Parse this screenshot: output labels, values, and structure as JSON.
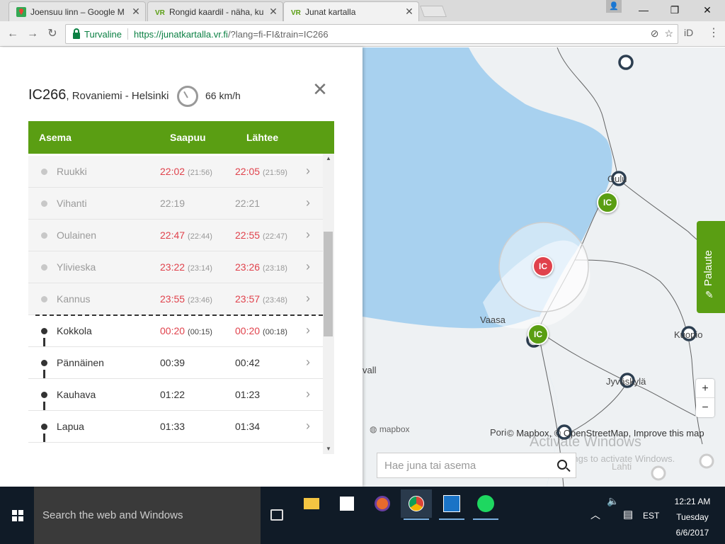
{
  "browser": {
    "tabs": [
      {
        "title": "Joensuu linn – Google M",
        "favicon": "google-maps-icon",
        "active": false
      },
      {
        "title": "Rongid kaardil - näha, ku",
        "favicon": "vr-icon",
        "active": false
      },
      {
        "title": "Junat kartalla",
        "favicon": "vr-icon",
        "active": true
      }
    ],
    "secure_label": "Turvaline",
    "url_main": "https://junatkartalla.vr.fi",
    "url_rest": "/?lang=fi-FI&train=IC266",
    "profile_label": "iD"
  },
  "panel": {
    "train_id": "IC266",
    "route": ", Rovaniemi - Helsinki",
    "speed": "66 km/h",
    "columns": {
      "station": "Asema",
      "arrival": "Saapuu",
      "departure": "Lähtee"
    },
    "accent_color": "#5a9e13",
    "late_color": "#e0424c",
    "stops": [
      {
        "station": "Ruukki",
        "arr": "22:02",
        "arr_sched": "(21:56)",
        "dep": "22:05",
        "dep_sched": "(21:59)",
        "late": true,
        "passed": true
      },
      {
        "station": "Vihanti",
        "arr": "22:19",
        "arr_sched": "",
        "dep": "22:21",
        "dep_sched": "",
        "late": false,
        "passed": true
      },
      {
        "station": "Oulainen",
        "arr": "22:47",
        "arr_sched": "(22:44)",
        "dep": "22:55",
        "dep_sched": "(22:47)",
        "late": true,
        "passed": true
      },
      {
        "station": "Ylivieska",
        "arr": "23:22",
        "arr_sched": "(23:14)",
        "dep": "23:26",
        "dep_sched": "(23:18)",
        "late": true,
        "passed": true
      },
      {
        "station": "Kannus",
        "arr": "23:55",
        "arr_sched": "(23:46)",
        "dep": "23:57",
        "dep_sched": "(23:48)",
        "late": true,
        "passed": true
      },
      {
        "station": "Kokkola",
        "arr": "00:20",
        "arr_sched": "(00:15)",
        "dep": "00:20",
        "dep_sched": "(00:18)",
        "late": true,
        "passed": false
      },
      {
        "station": "Pännäinen",
        "arr": "00:39",
        "arr_sched": "",
        "dep": "00:42",
        "dep_sched": "",
        "late": false,
        "passed": false
      },
      {
        "station": "Kauhava",
        "arr": "01:22",
        "arr_sched": "",
        "dep": "01:23",
        "dep_sched": "",
        "late": false,
        "passed": false
      },
      {
        "station": "Lapua",
        "arr": "01:33",
        "arr_sched": "",
        "dep": "01:34",
        "dep_sched": "",
        "late": false,
        "passed": false
      }
    ]
  },
  "map": {
    "labels": {
      "vaasa": "Vaasa",
      "kuopio": "Kuopio",
      "jyvaskyla": "Jyväskylä",
      "oulu": "Oulu",
      "vall": "vall",
      "pori": "Pori",
      "lahti": "Lahti"
    },
    "train_badges": [
      "IC",
      "IC",
      "IC"
    ],
    "attribution": "© Mapbox, © OpenStreetMap, Improve this map",
    "mapbox_logo": "mapbox",
    "zoom_in": "+",
    "zoom_out": "−",
    "feedback": "Palaute",
    "search_placeholder": "Hae juna tai asema",
    "watermark_title": "Activate Windows",
    "watermark_sub": "Go to Settings to activate Windows."
  },
  "taskbar": {
    "search_placeholder": "Search the web and Windows",
    "language": "EST",
    "time": "12:21 AM",
    "day": "Tuesday",
    "date": "6/6/2017"
  }
}
